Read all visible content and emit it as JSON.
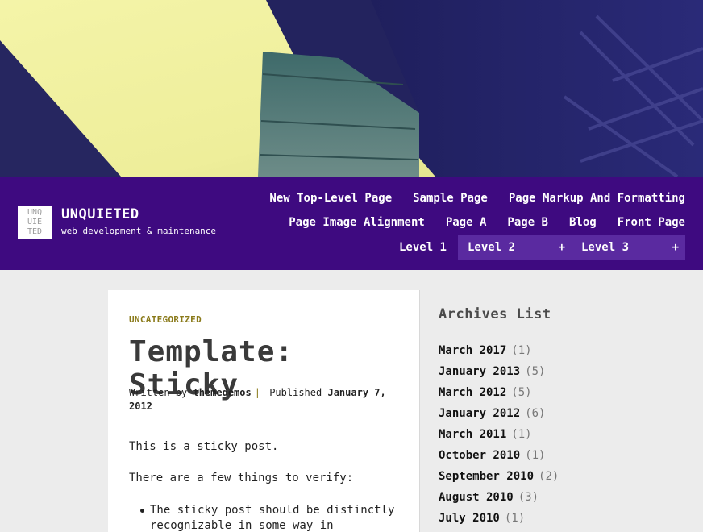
{
  "site": {
    "logo_lines": [
      "UNQ",
      "UIE",
      "TED"
    ],
    "title": "UNQUIETED",
    "description": "web development & maintenance"
  },
  "nav": {
    "row1": [
      "New Top-Level Page",
      "Sample Page",
      "Page Markup And Formatting"
    ],
    "row2": [
      "Page Image Alignment",
      "Page A",
      "Page B",
      "Blog",
      "Front Page"
    ],
    "level1": "Level 1",
    "level2": "Level 2",
    "level3": "Level 3",
    "expand_symbol": "+"
  },
  "post": {
    "category": "UNCATEGORIZED",
    "title": "Template: Sticky",
    "meta_written_prefix": "Written by",
    "author": "themedemos",
    "meta_separator": "|",
    "meta_published_prefix": "Published",
    "date": "January 7, 2012",
    "paragraph1": "This is a sticky post.",
    "paragraph2": "There are a few things to verify:",
    "bullet1": "The sticky post should be distinctly recognizable in some way in"
  },
  "sidebar": {
    "title": "Archives List",
    "archives": [
      {
        "label": "March 2017",
        "count": "(1)"
      },
      {
        "label": "January 2013",
        "count": "(5)"
      },
      {
        "label": "March 2012",
        "count": "(5)"
      },
      {
        "label": "January 2012",
        "count": "(6)"
      },
      {
        "label": "March 2011",
        "count": "(1)"
      },
      {
        "label": "October 2010",
        "count": "(1)"
      },
      {
        "label": "September 2010",
        "count": "(2)"
      },
      {
        "label": "August 2010",
        "count": "(3)"
      },
      {
        "label": "July 2010",
        "count": "(1)"
      }
    ]
  },
  "colors": {
    "header_bg": "#3e0a80",
    "submenu_bg": "#5a2aa0",
    "category": "#8a7a1a",
    "page_bg": "#ececec"
  }
}
